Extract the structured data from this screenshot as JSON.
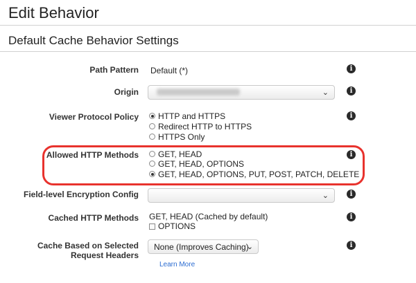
{
  "page": {
    "title": "Edit Behavior",
    "section_title": "Default Cache Behavior Settings"
  },
  "form": {
    "path_pattern": {
      "label": "Path Pattern",
      "value": "Default (*)"
    },
    "origin": {
      "label": "Origin",
      "value": ""
    },
    "viewer_protocol_policy": {
      "label": "Viewer Protocol Policy",
      "options": [
        "HTTP and HTTPS",
        "Redirect HTTP to HTTPS",
        "HTTPS Only"
      ],
      "selected": "HTTP and HTTPS"
    },
    "allowed_http_methods": {
      "label": "Allowed HTTP Methods",
      "options": [
        "GET, HEAD",
        "GET, HEAD, OPTIONS",
        "GET, HEAD, OPTIONS, PUT, POST, PATCH, DELETE"
      ],
      "selected": "GET, HEAD, OPTIONS, PUT, POST, PATCH, DELETE"
    },
    "field_level_encryption": {
      "label": "Field-level Encryption Config",
      "value": ""
    },
    "cached_http_methods": {
      "label": "Cached HTTP Methods",
      "text": "GET, HEAD (Cached by default)",
      "checkbox_label": "OPTIONS",
      "checked": false
    },
    "cache_headers": {
      "label_line1": "Cache Based on Selected",
      "label_line2": "Request Headers",
      "value": "None (Improves Caching)",
      "learn_more": "Learn More"
    }
  },
  "icons": {
    "info": "info-icon",
    "dropdown": "chevron-down-icon"
  },
  "colors": {
    "highlight": "#e8322d",
    "link": "#2a6bd1"
  }
}
